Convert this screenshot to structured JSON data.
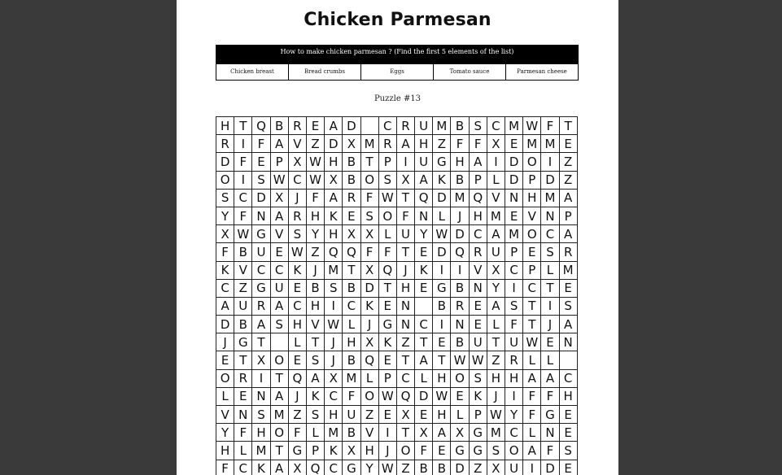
{
  "title": "Chicken Parmesan",
  "banner": "How to make chicken parmesan ? (Find the first 5 elements of the list)",
  "words": [
    "Chicken breast",
    "Bread crumbs",
    "Eggs",
    "Tomato sauce",
    "Parmesan cheese"
  ],
  "puzzle_label": "Puzzle #13",
  "grid": [
    "HTQBREAD CRUMBSCMWFT",
    "RIFAVZDXMRAHZFFXEMME",
    "DFEPXWHBTPIUGHAIDOIZ",
    "OISWCWXBOSXAKBPLDPDZ",
    "SCDXJFARFWTQDMQVNHMA",
    "YFNARHKESOFNLJHMEVNP",
    "XWGVSYHXXLUYWDCAMOCA",
    "FBUEWZQQFFTEDQRUPESR",
    "KVCCKJMTXQJKIIVXCPLM",
    "CZGUEBSBDTHEGBNYICTE",
    "AURACHICKEN BREASTIS",
    "DBASHVWLJGNCINELFTJA",
    "JGT LTJHXKZTEBUTUWEN",
    "ETXOESJBQETATWWZRLL ",
    "ORITQAXMLPCLHOSHHAAC",
    "LENAJKCFOWQDWEKJIFFH",
    "VNSMZSHUZEXEHLPWYFGE",
    "YFHOFLMBVITXAXGMCLNE",
    "HLMTGPKXHJOFEGGSOAFS",
    "FCKAXQCGYWZBBDZXUIDE"
  ]
}
